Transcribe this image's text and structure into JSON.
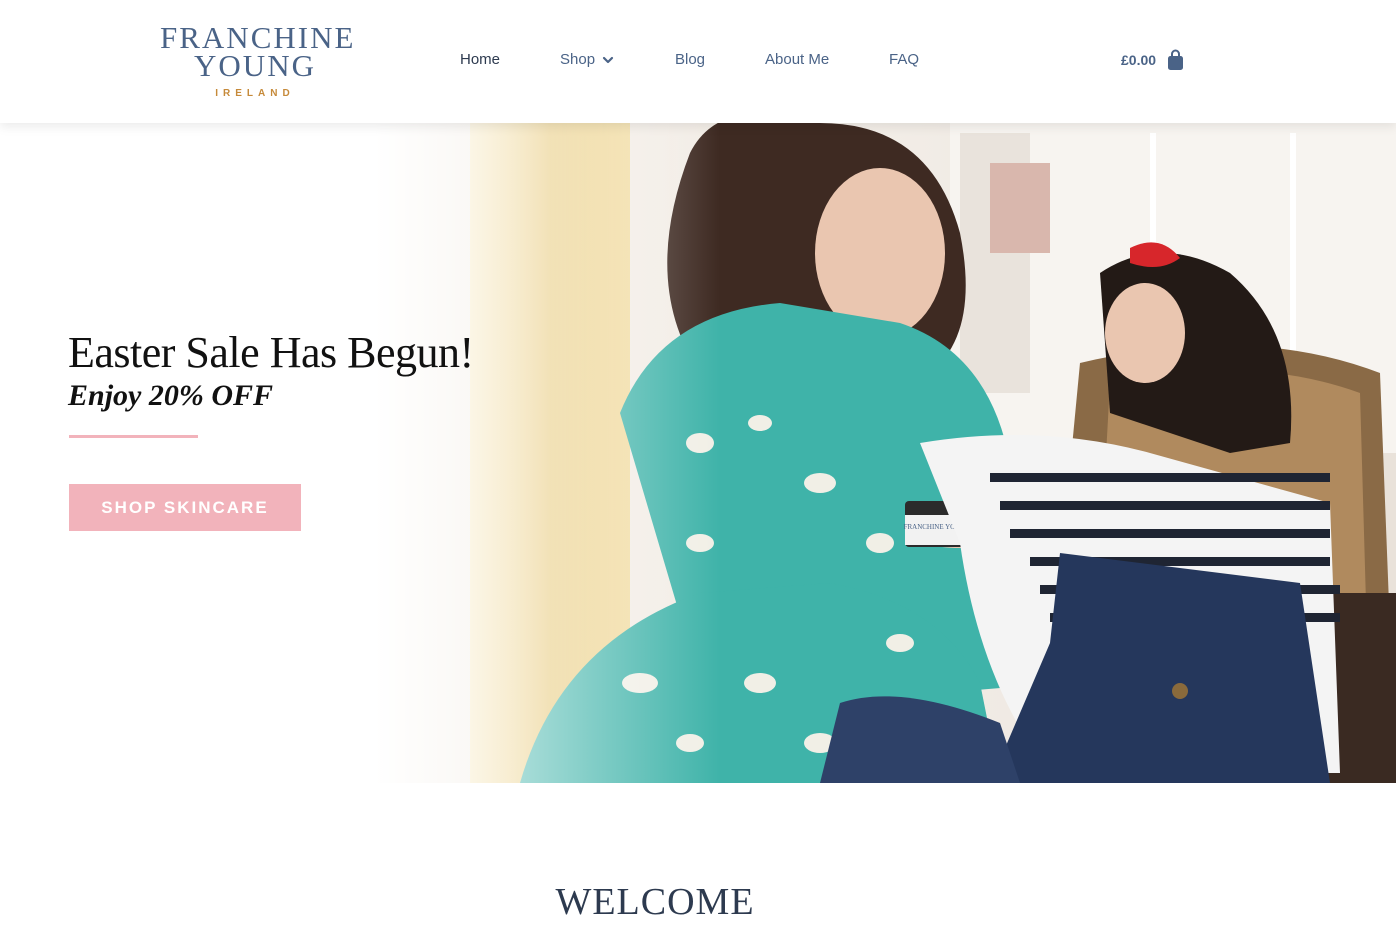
{
  "brand": {
    "line1": "FRANCHINE",
    "line2": "YOUNG",
    "line3": "IRELAND",
    "primary_color": "#4a6387",
    "accent_color": "#c68a3a"
  },
  "nav": {
    "items": [
      {
        "label": "Home",
        "active": true
      },
      {
        "label": "Shop",
        "has_dropdown": true
      },
      {
        "label": "Blog"
      },
      {
        "label": "About Me"
      },
      {
        "label": "FAQ"
      }
    ]
  },
  "cart": {
    "total": "£0.00",
    "icon": "shopping-bag-icon"
  },
  "hero": {
    "title": "Easter Sale Has Begun!",
    "subtitle": "Enjoy 20% OFF",
    "cta_label": "SHOP SKINCARE",
    "cta_color": "#f2b3bb",
    "product_label": "FRANCHINE YOUNG"
  },
  "section": {
    "heading": "WELCOME"
  }
}
